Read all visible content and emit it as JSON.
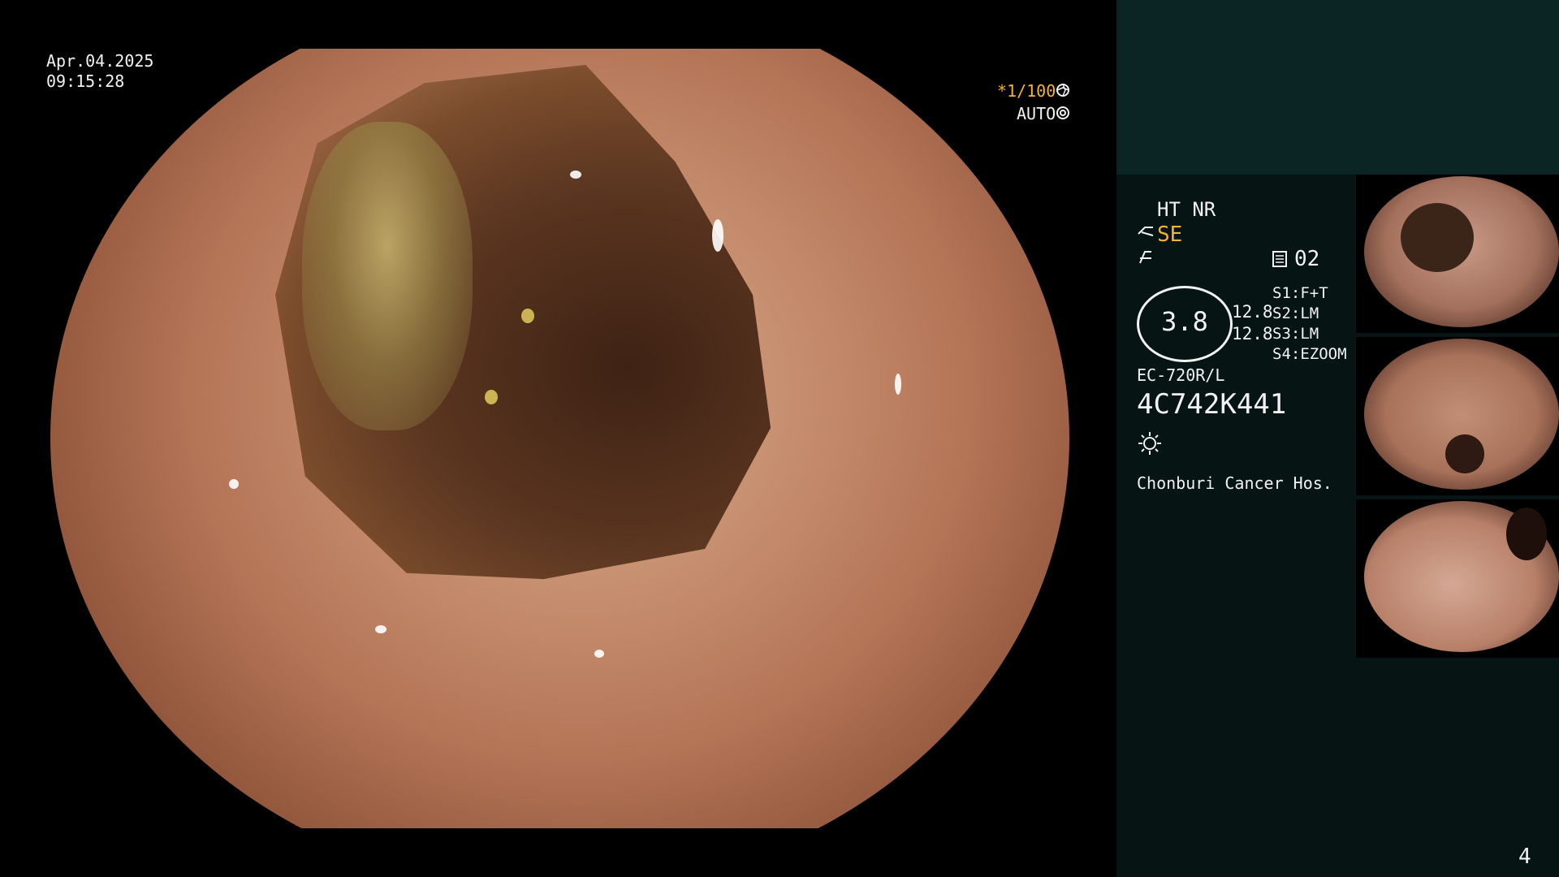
{
  "overlay": {
    "date": "Apr.04.2025",
    "time": "09:15:28",
    "shutter": "*1/100",
    "iris": "AUTO"
  },
  "side_panel": {
    "ht_nr": "HT NR",
    "se_label": "SE",
    "page_code": "02",
    "zoom_value": "3.8",
    "ratio_top": "12.8",
    "ratio_bottom": "12.8",
    "settings": [
      {
        "key": "S1",
        "value": "F+T"
      },
      {
        "key": "S2",
        "value": "LM"
      },
      {
        "key": "S3",
        "value": "LM"
      },
      {
        "key": "S4",
        "value": "EZOOM"
      }
    ],
    "scope_model": "EC-720R/L",
    "scope_serial": "4C742K441",
    "hospital": "Chonburi Cancer Hos.",
    "page_number": "4"
  },
  "thumbnails": [
    {
      "name": "capture-1"
    },
    {
      "name": "capture-2"
    },
    {
      "name": "capture-3"
    }
  ],
  "icons": {
    "shutter_icon": "aperture-icon",
    "iris_icon": "iris-icon",
    "scope_icon": "scope-tip-icon",
    "light_icon": "light-icon",
    "memory_icon": "memory-icon",
    "brightness_icon": "brightness-icon"
  },
  "colors": {
    "accent": "#f5b233",
    "panel_bg": "#071414",
    "panel_top_bg": "#0b2424"
  }
}
